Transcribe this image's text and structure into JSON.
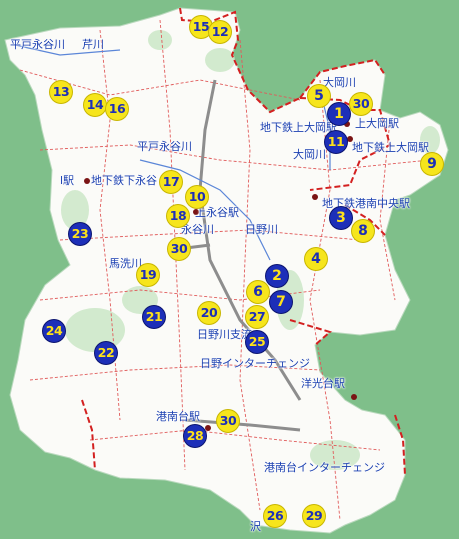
{
  "map": {
    "colors": {
      "background": "#7fbf8a",
      "land": "#ffffff",
      "marker_blue": "#1d2fb8",
      "marker_yellow": "#f6e51c",
      "boundary": "#d32020",
      "road": "#e05a5a",
      "label": "#1a3fb0"
    },
    "labels": {
      "hirado_eiyagawa": "平戸永谷川",
      "serigawa": "芹川",
      "ooka_river": "大岡川",
      "kamiooka_station": "上大岡駅",
      "subway_kamiooka": "地下鉄上大岡駅",
      "ooka_river_2": "大岡川",
      "subway_kamiooka_2": "地下鉄上大岡駅",
      "hirado_eiyagawa_2": "平戸永谷川",
      "station_left": "l駅",
      "subway_shimonagaya": "地下鉄下永谷",
      "eiyagawa_river": "永谷川",
      "kaminagaya_station": "上永谷駅",
      "hinogawa": "日野川",
      "subway_konanchuo": "地下鉄港南中央駅",
      "maaraigawa": "馬洗川",
      "hinogawa_branch": "日野川支流",
      "hino_ic": "日野インターチェンジ",
      "yokodai_station": "洋光台駅",
      "konandai_station": "港南台駅",
      "konandai_ic": "港南台インターチェンジ",
      "sawa": "沢"
    },
    "markers": [
      {
        "n": "15",
        "style": "yellow"
      },
      {
        "n": "12",
        "style": "yellow"
      },
      {
        "n": "13",
        "style": "yellow"
      },
      {
        "n": "14",
        "style": "yellow"
      },
      {
        "n": "16",
        "style": "yellow"
      },
      {
        "n": "5",
        "style": "yellow"
      },
      {
        "n": "1",
        "style": "blue"
      },
      {
        "n": "30",
        "style": "yellow"
      },
      {
        "n": "11",
        "style": "blue"
      },
      {
        "n": "9",
        "style": "yellow"
      },
      {
        "n": "17",
        "style": "yellow"
      },
      {
        "n": "10",
        "style": "yellow"
      },
      {
        "n": "18",
        "style": "yellow"
      },
      {
        "n": "30",
        "style": "yellow"
      },
      {
        "n": "23",
        "style": "blue"
      },
      {
        "n": "3",
        "style": "blue"
      },
      {
        "n": "8",
        "style": "yellow"
      },
      {
        "n": "4",
        "style": "yellow"
      },
      {
        "n": "2",
        "style": "blue"
      },
      {
        "n": "19",
        "style": "yellow"
      },
      {
        "n": "6",
        "style": "yellow"
      },
      {
        "n": "7",
        "style": "blue"
      },
      {
        "n": "24",
        "style": "blue"
      },
      {
        "n": "21",
        "style": "blue"
      },
      {
        "n": "20",
        "style": "yellow"
      },
      {
        "n": "27",
        "style": "yellow"
      },
      {
        "n": "25",
        "style": "blue"
      },
      {
        "n": "22",
        "style": "blue"
      },
      {
        "n": "30",
        "style": "yellow"
      },
      {
        "n": "28",
        "style": "blue"
      },
      {
        "n": "26",
        "style": "yellow"
      },
      {
        "n": "29",
        "style": "yellow"
      }
    ]
  }
}
